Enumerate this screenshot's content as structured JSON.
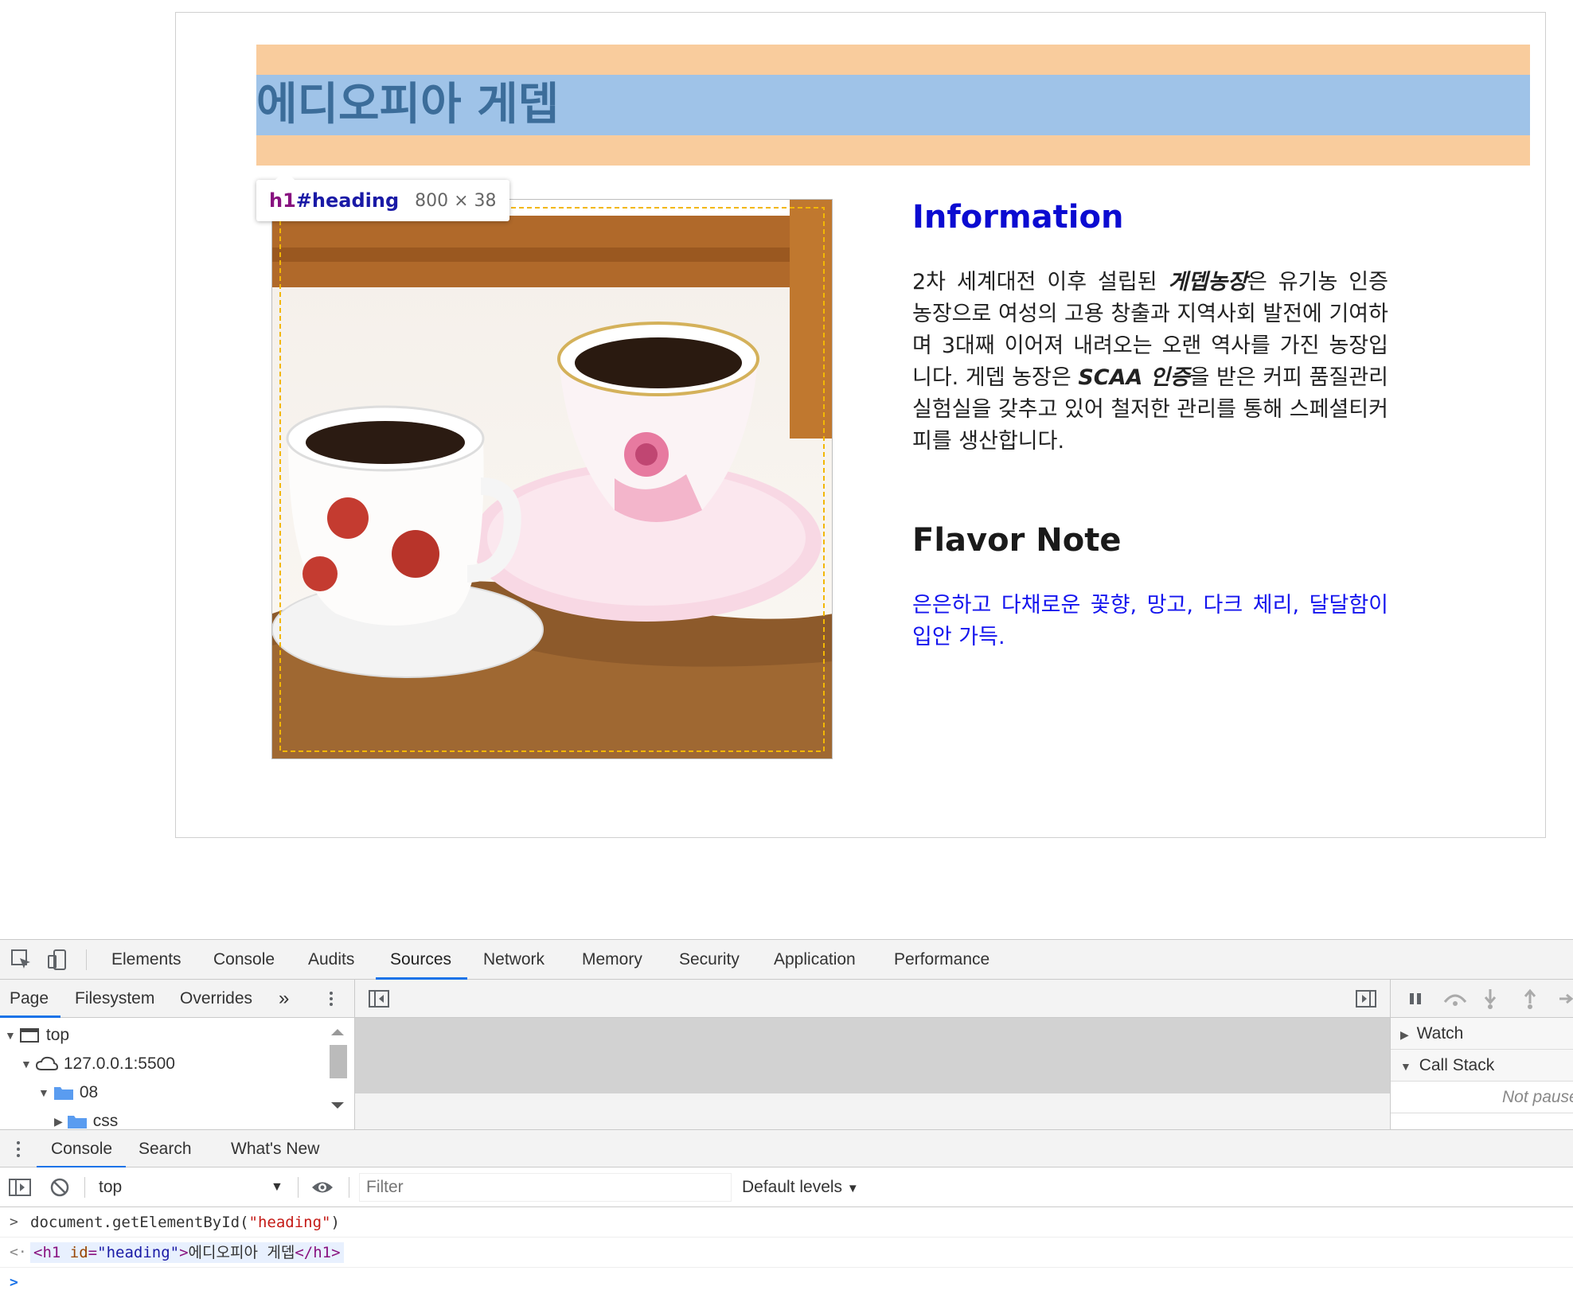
{
  "page": {
    "heading": "에디오피아 게뎁",
    "tooltip": {
      "tag": "h1",
      "id": "#heading",
      "size": "800 × 38"
    },
    "info_heading": "Information",
    "info_text_parts": {
      "p1": "2차 세계대전 이후 설립된 ",
      "em1": "게뎁농장",
      "p2": "은 유기농 인증 농장으로 여성의 고용 창출과 지역사회 발전에 기여하며 3대째 이어져 내려오는 오랜 역사를 가진 농장입니다. 게뎁 농장은 ",
      "em2": "SCAA 인증",
      "p3": "을 받은 커피 품질관리 실험실을 갖추고 있어 철저한 관리를 통해 스페셜티커피를 생산합니다."
    },
    "flavor_heading": "Flavor Note",
    "flavor_text": "은은하고 다채로운 꽃향, 망고, 다크 체리, 달달함이 입안 가득."
  },
  "colors": {
    "margin_overlay": "#f9cc9d",
    "content_overlay": "#9fc3e8",
    "info_heading": "#0b0bd1",
    "flavor_text": "#1515ee",
    "tab_underline": "#1a73e8"
  },
  "devtools": {
    "main_tabs": [
      "Elements",
      "Console",
      "Audits",
      "Sources",
      "Network",
      "Memory",
      "Security",
      "Application",
      "Performance"
    ],
    "active_tab": "Sources",
    "nav_tabs": [
      "Page",
      "Filesystem",
      "Overrides"
    ],
    "nav_more": "»",
    "tree": [
      "top",
      "127.0.0.1:5500",
      "08",
      "css"
    ],
    "debugger": {
      "watch": "Watch",
      "call_stack": "Call Stack",
      "status": "Not paused"
    },
    "drawer_tabs": [
      "Console",
      "Search",
      "What's New"
    ],
    "console_toolbar": {
      "context": "top",
      "filter_placeholder": "Filter",
      "levels": "Default levels"
    },
    "console": {
      "input_prefix": "document.getElementById(",
      "input_arg": "\"heading\"",
      "input_suffix": ")",
      "out_open": "<h1",
      "out_attr": "id",
      "out_eq": "=",
      "out_val": "\"heading\"",
      "out_close": ">",
      "out_text": "에디오피아 게뎁",
      "out_end": "</h1>"
    },
    "icons": [
      "inspect-icon",
      "device-toggle-icon",
      "kebab-menu-icon",
      "sidebar-toggle-icon",
      "pause-icon",
      "step-over-icon",
      "step-into-icon",
      "step-out-icon",
      "clear-console-icon",
      "eye-icon"
    ]
  }
}
